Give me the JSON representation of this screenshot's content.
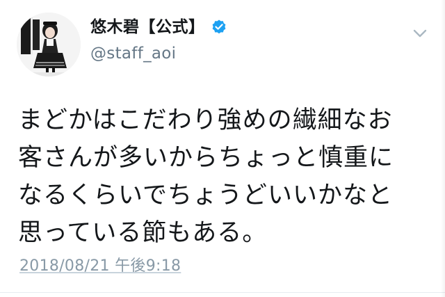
{
  "tweet": {
    "display_name": "悠木碧【公式】",
    "verified": true,
    "handle": "@staff_aoi",
    "menu_icon": "chevron-down-icon",
    "text_lines": [
      "まどかはこだわり強めの繊細なお",
      "客さんが多いからちょっと慎重に",
      "なるくらいでちょうどいいかなと",
      "思っている節もある。"
    ],
    "timestamp": "2018/08/21 午後9:18"
  },
  "colors": {
    "text": "#14171a",
    "secondary": "#657786",
    "timestamp": "#8899a6",
    "verified_badge": "#1da1f2"
  }
}
